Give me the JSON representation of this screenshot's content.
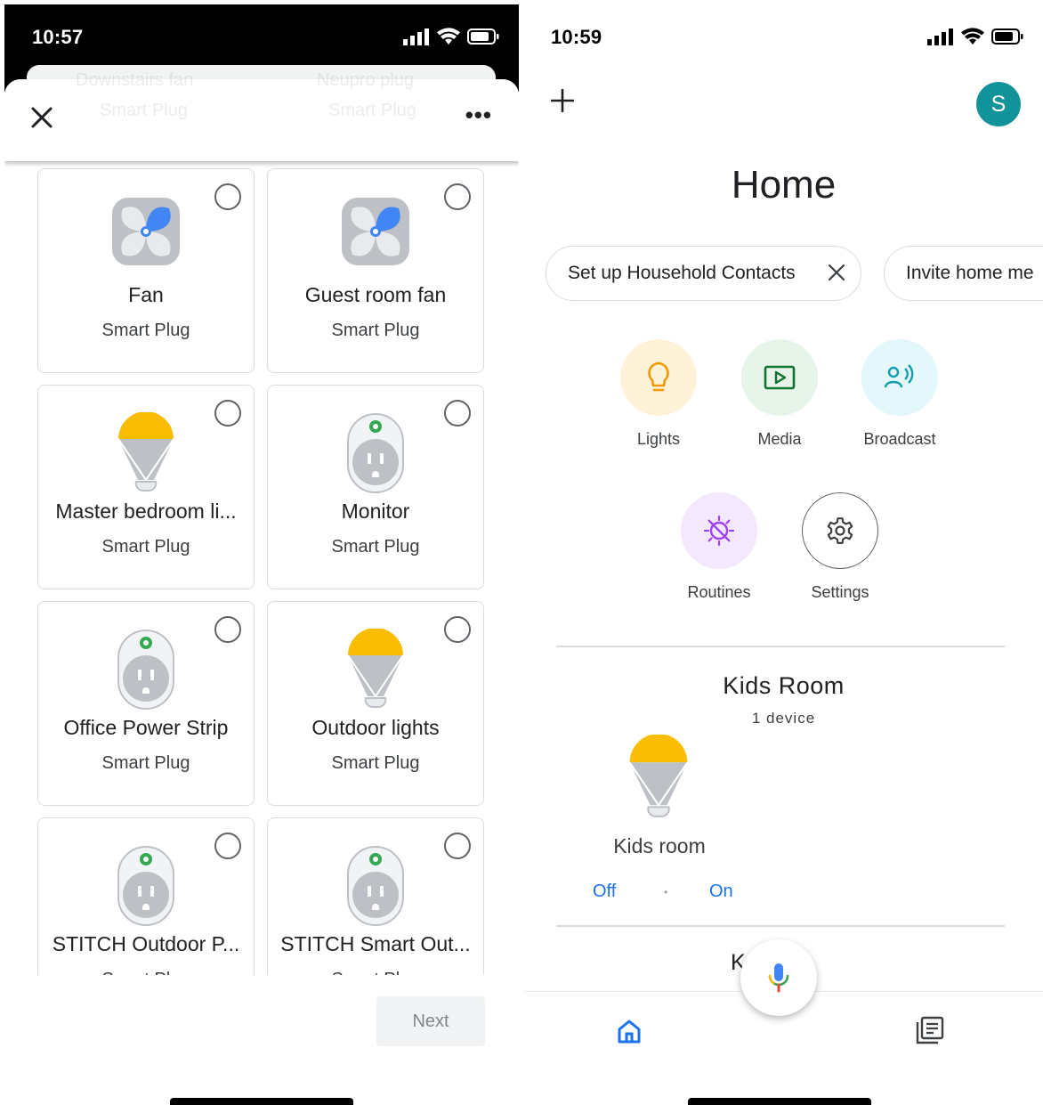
{
  "left_screen": {
    "status": {
      "time": "10:57"
    },
    "ghost_header": {
      "texts": [
        "Downstairs fan",
        "Smart Plug",
        "Neupro plug",
        "Smart Plug"
      ]
    },
    "devices": [
      {
        "name": "Fan",
        "type": "Smart Plug",
        "icon": "fan-icon"
      },
      {
        "name": "Guest room fan",
        "type": "Smart Plug",
        "icon": "fan-icon"
      },
      {
        "name": "Master bedroom li...",
        "type": "Smart Plug",
        "icon": "light-bulb-icon"
      },
      {
        "name": "Monitor",
        "type": "Smart Plug",
        "icon": "outlet-icon"
      },
      {
        "name": "Office Power Strip",
        "type": "Smart Plug",
        "icon": "outlet-icon"
      },
      {
        "name": "Outdoor lights",
        "type": "Smart Plug",
        "icon": "light-bulb-icon"
      },
      {
        "name": "STITCH Outdoor P...",
        "type": "Smart Plug",
        "icon": "outlet-icon"
      },
      {
        "name": "STITCH Smart Out...",
        "type": "Smart Plug",
        "icon": "outlet-icon"
      }
    ],
    "next_label": "Next"
  },
  "right_screen": {
    "status": {
      "time": "10:59"
    },
    "avatar_initial": "S",
    "title": "Home",
    "chips": {
      "household": "Set up Household Contacts",
      "invite": "Invite home me"
    },
    "actions": {
      "lights": "Lights",
      "media": "Media",
      "broadcast": "Broadcast",
      "routines": "Routines",
      "settings": "Settings"
    },
    "room": {
      "name": "Kids Room",
      "count": "1 device",
      "device_name": "Kids room",
      "off_label": "Off",
      "on_label": "On",
      "dot": "•"
    },
    "next_room_partial": "K          n"
  },
  "colors": {
    "accent_blue": "#1a73e8",
    "avatar_teal": "#12939a",
    "bulb_yellow": "#fbbc04",
    "outlet_green": "#34a853"
  }
}
